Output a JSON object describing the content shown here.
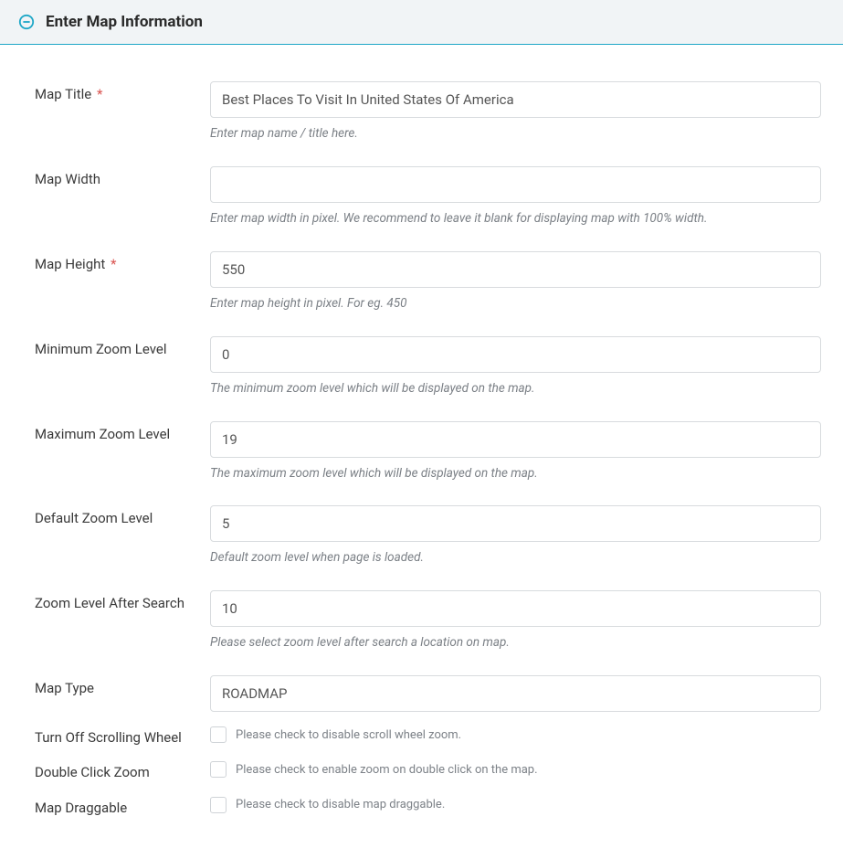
{
  "header": {
    "title": "Enter Map Information"
  },
  "fields": {
    "map_title": {
      "label": "Map Title",
      "required_mark": "*",
      "value": "Best Places To Visit In United States Of America",
      "help": "Enter map name / title here."
    },
    "map_width": {
      "label": "Map Width",
      "value": "",
      "help": "Enter map width in pixel. We recommend to leave it blank for displaying map with 100% width."
    },
    "map_height": {
      "label": "Map Height",
      "required_mark": "*",
      "value": "550",
      "help": "Enter map height in pixel. For eg. 450"
    },
    "min_zoom": {
      "label": "Minimum Zoom Level",
      "value": "0",
      "help": "The minimum zoom level which will be displayed on the map."
    },
    "max_zoom": {
      "label": "Maximum Zoom Level",
      "value": "19",
      "help": "The maximum zoom level which will be displayed on the map."
    },
    "default_zoom": {
      "label": "Default Zoom Level",
      "value": "5",
      "help": "Default zoom level when page is loaded."
    },
    "zoom_after_search": {
      "label": "Zoom Level After Search",
      "value": "10",
      "help": "Please select zoom level after search a location on map."
    },
    "map_type": {
      "label": "Map Type",
      "value": "ROADMAP"
    },
    "scroll_wheel": {
      "label": "Turn Off Scrolling Wheel",
      "checkbox_label": "Please check to disable scroll wheel zoom."
    },
    "double_click_zoom": {
      "label": "Double Click Zoom",
      "checkbox_label": "Please check to enable zoom on double click on the map."
    },
    "map_draggable": {
      "label": "Map Draggable",
      "checkbox_label": "Please check to disable map draggable."
    }
  }
}
